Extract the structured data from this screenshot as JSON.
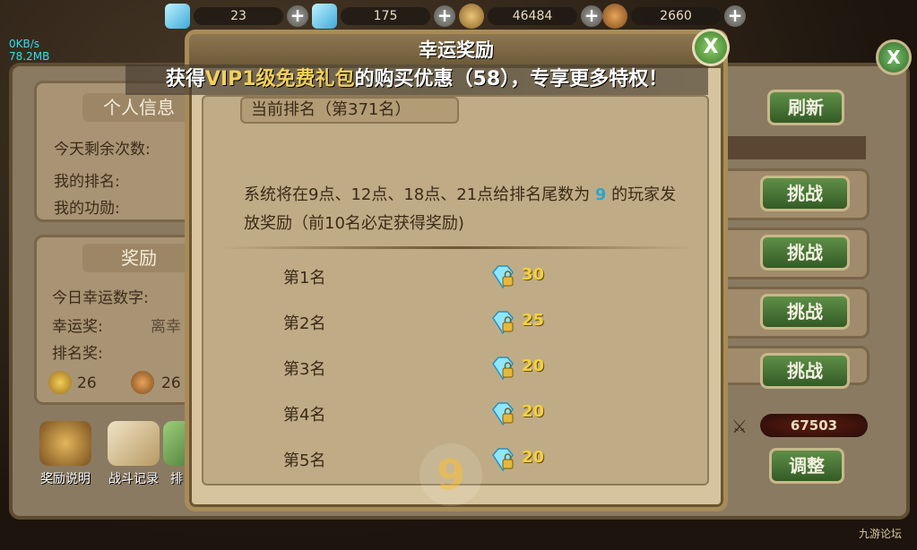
{
  "top_bar": {
    "resources": [
      {
        "icon": "diamond-icon",
        "value": "23"
      },
      {
        "icon": "locked-diamond-icon",
        "value": "175"
      },
      {
        "icon": "coin-icon",
        "value": "46484"
      },
      {
        "icon": "badge-icon",
        "value": "2660"
      }
    ],
    "plus_label": "+"
  },
  "net_info": {
    "speed": "0KB/s",
    "memory": "78.2MB"
  },
  "banner": {
    "prefix": "获得",
    "highlight": "VIP1级免费礼包",
    "suffix": "的购买优惠（58），专享更多特权！"
  },
  "background": {
    "close_label": "X",
    "personal_head": "个人信息",
    "remaining_label": "今天剩余次数:",
    "my_rank_label": "我的排名:",
    "my_merit_label": "我的功勋:",
    "reward_head": "奖励",
    "lucky_number_label": "今日幸运数字:",
    "lucky_prize_label": "幸运奖:",
    "lucky_prize_value": "离幸",
    "rank_prize_label": "排名奖:",
    "prize_a": "26",
    "prize_b": "26",
    "refresh_label": "刷新",
    "challenge_label": "挑战",
    "adjust_label": "调整",
    "score": "67503",
    "tools": [
      {
        "icon": "money-bag-icon",
        "label": "奖励说明"
      },
      {
        "icon": "magnifier-scroll-icon",
        "label": "战斗记录"
      },
      {
        "icon": "list-icon",
        "label": "排"
      }
    ]
  },
  "modal": {
    "title": "幸运奖励",
    "close_label": "X",
    "current_rank": "当前排名（第371名）",
    "desc_pre": "系统将在9点、12点、18点、21点给排名尾数为 ",
    "lucky_digit": "9",
    "desc_post": " 的玩家发放奖励（前10名必定获得奖励)",
    "rewards": [
      {
        "rank": "第1名",
        "icon": "locked-diamond-icon",
        "amount": "30"
      },
      {
        "rank": "第2名",
        "icon": "locked-diamond-icon",
        "amount": "25"
      },
      {
        "rank": "第3名",
        "icon": "locked-diamond-icon",
        "amount": "20"
      },
      {
        "rank": "第4名",
        "icon": "locked-diamond-icon",
        "amount": "20"
      },
      {
        "rank": "第5名",
        "icon": "locked-diamond-icon",
        "amount": "20"
      }
    ],
    "watermark": "9"
  },
  "corner_logo": "九游论坛"
}
